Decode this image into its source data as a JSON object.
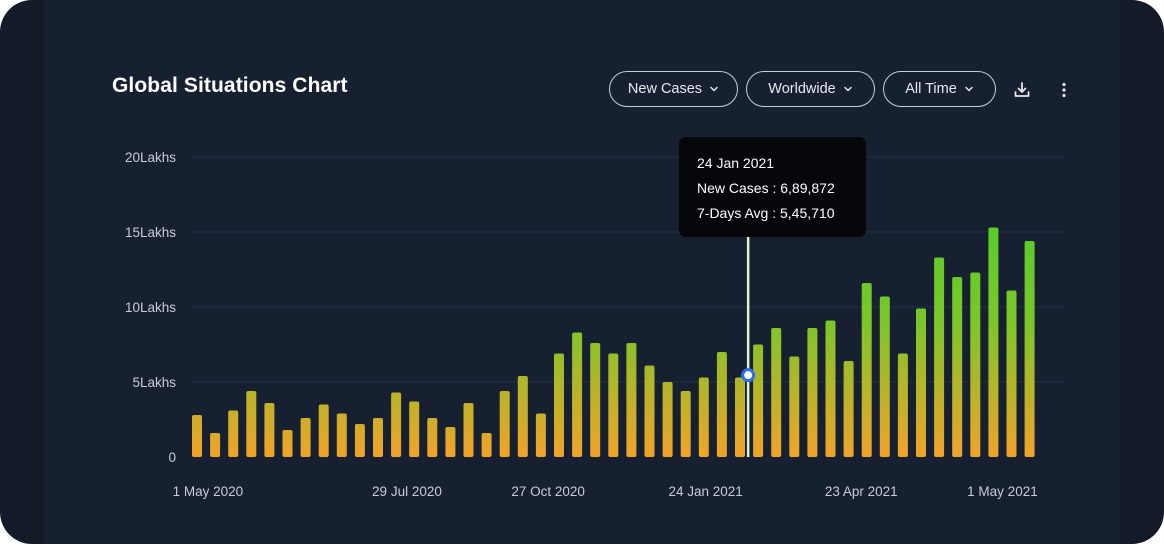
{
  "header": {
    "title": "Global Situations Chart",
    "filters": [
      {
        "label": "New Cases"
      },
      {
        "label": "Worldwide"
      },
      {
        "label": "All Time"
      }
    ],
    "download_icon": "download-icon",
    "more_icon": "more-vertical-icon"
  },
  "colors": {
    "background": "#131b29",
    "card": "#172030",
    "bar_top": "#3fd02a",
    "bar_bottom": "#f0a32a",
    "grid": "#263246",
    "highlight_line": "#d9f5d6",
    "marker": "#2f6df0"
  },
  "tooltip": {
    "date": "24 Jan 2021",
    "line1": "New Cases : 6,89,872",
    "line2": "7-Days Avg : 5,45,710"
  },
  "chart_data": {
    "type": "bar",
    "title": "Global Situations Chart",
    "ylim": [
      0,
      20
    ],
    "yticks": [
      {
        "value": 0,
        "label": "0"
      },
      {
        "value": 5,
        "label": "5Lakhs"
      },
      {
        "value": 10,
        "label": "10Lakhs"
      },
      {
        "value": 15,
        "label": "15Lakhs"
      },
      {
        "value": 20,
        "label": "20Lakhs"
      }
    ],
    "xticks": [
      {
        "index": 0.6,
        "label": "1 May 2020"
      },
      {
        "index": 11.6,
        "label": "29 Jul 2020"
      },
      {
        "index": 19.4,
        "label": "27 Oct 2020"
      },
      {
        "index": 28.1,
        "label": "24 Jan 2021"
      },
      {
        "index": 36.7,
        "label": "23 Apr 2021"
      },
      {
        "index": 44.5,
        "label": "1 May 2021"
      }
    ],
    "series": [
      {
        "values": [
          2.8,
          1.6,
          3.1,
          4.4,
          3.6,
          1.8,
          2.6,
          3.5,
          2.9,
          2.2,
          2.6,
          4.3,
          3.7,
          2.6,
          2.0,
          3.6,
          1.6,
          4.4,
          5.4,
          2.9,
          6.9,
          8.3,
          7.6,
          6.9,
          7.6,
          6.1,
          5.0,
          4.4,
          5.3,
          7.0,
          5.3,
          7.5,
          8.6,
          6.7,
          8.6,
          9.1,
          6.4,
          11.6,
          10.7,
          6.9,
          9.9,
          13.3,
          12.0,
          12.3,
          15.3,
          11.1,
          14.4
        ]
      }
    ],
    "highlight": {
      "x": "24 Jan 2021",
      "position_index": 30.45,
      "value": 5.4571
    }
  }
}
